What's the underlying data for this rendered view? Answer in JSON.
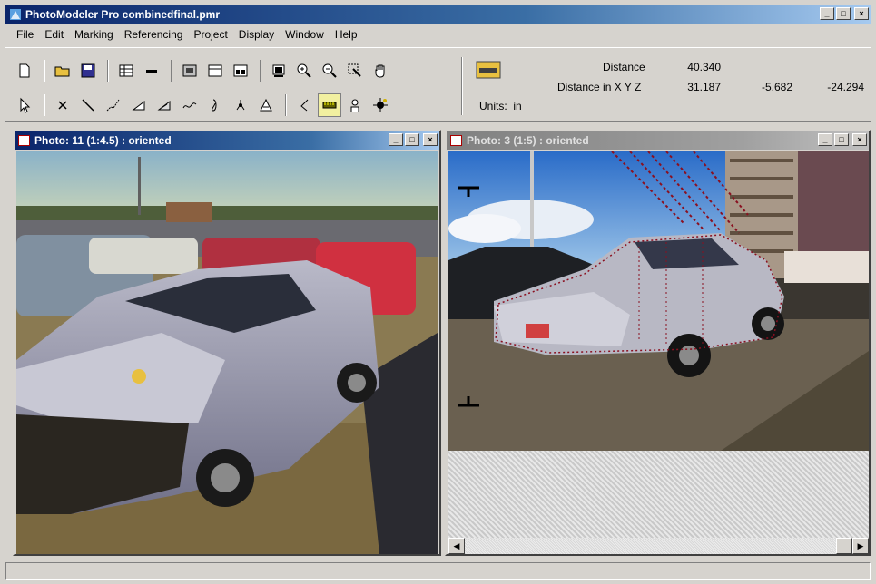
{
  "app": {
    "title": "PhotoModeler Pro combinedfinal.pmr"
  },
  "menu": [
    "File",
    "Edit",
    "Marking",
    "Referencing",
    "Project",
    "Display",
    "Window",
    "Help"
  ],
  "toolbar": {
    "row1_icons": [
      "new-file-icon",
      "open-folder-icon",
      "save-icon",
      "table-icon",
      "line-icon",
      "photo-view-icon",
      "3d-view-icon",
      "layout-icon",
      "fit-icon",
      "zoom-in-icon",
      "zoom-out-icon",
      "zoom-rect-icon",
      "pan-hand-icon"
    ],
    "row2_icons": [
      "pointer-icon",
      "point-mark-icon",
      "line-mark-icon",
      "curve-mark-icon",
      "surface-icon",
      "surface-draw-icon",
      "edge-icon",
      "cylinder-icon",
      "target-icon",
      "target-triangle-icon",
      "reference-icon",
      "measure-icon",
      "hand-marker-icon",
      "auto-mark-icon"
    ],
    "active_tool": "measure-icon"
  },
  "measure": {
    "distance_label": "Distance",
    "distance_value": "40.340",
    "xyz_label": "Distance in X Y Z",
    "x": "31.187",
    "y": "-5.682",
    "z": "-24.294",
    "units_label": "Units:",
    "units_value": "in"
  },
  "windows": [
    {
      "title": "Photo: 11 (1:4.5) : oriented",
      "state": "active"
    },
    {
      "title": "Photo: 3 (1:5) : oriented",
      "state": "inactive"
    }
  ],
  "colors": {
    "title_active": "#0a246a",
    "title_inactive": "#808080",
    "face": "#d6d3ce"
  }
}
